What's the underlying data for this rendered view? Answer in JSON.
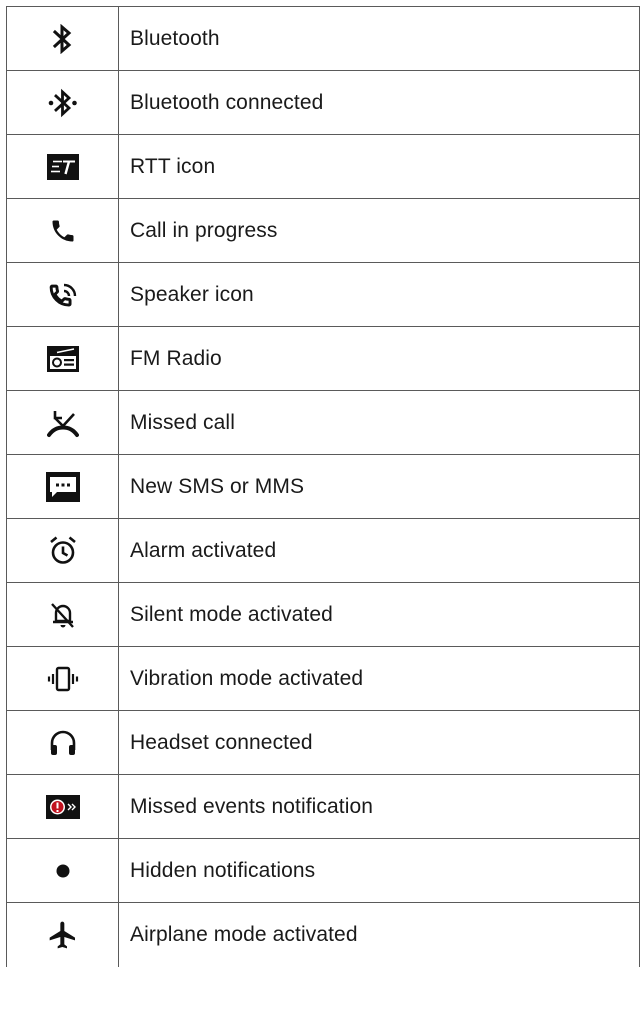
{
  "table": {
    "rows": [
      {
        "icon": "bluetooth-icon",
        "label": "Bluetooth"
      },
      {
        "icon": "bluetooth-connected-icon",
        "label": "Bluetooth connected"
      },
      {
        "icon": "rtt-icon",
        "label": "RTT icon"
      },
      {
        "icon": "call-in-progress-icon",
        "label": "Call in progress"
      },
      {
        "icon": "speaker-call-icon",
        "label": "Speaker icon"
      },
      {
        "icon": "fm-radio-icon",
        "label": "FM Radio"
      },
      {
        "icon": "missed-call-icon",
        "label": "Missed call"
      },
      {
        "icon": "new-message-icon",
        "label": "New SMS or MMS"
      },
      {
        "icon": "alarm-icon",
        "label": "Alarm activated"
      },
      {
        "icon": "silent-mode-icon",
        "label": "Silent mode activated"
      },
      {
        "icon": "vibration-icon",
        "label": "Vibration mode activated"
      },
      {
        "icon": "headset-icon",
        "label": "Headset connected"
      },
      {
        "icon": "missed-events-icon",
        "label": "Missed events notification"
      },
      {
        "icon": "hidden-notifications-dot-icon",
        "label": "Hidden notifications"
      },
      {
        "icon": "airplane-icon",
        "label": "Airplane mode activated"
      }
    ]
  }
}
